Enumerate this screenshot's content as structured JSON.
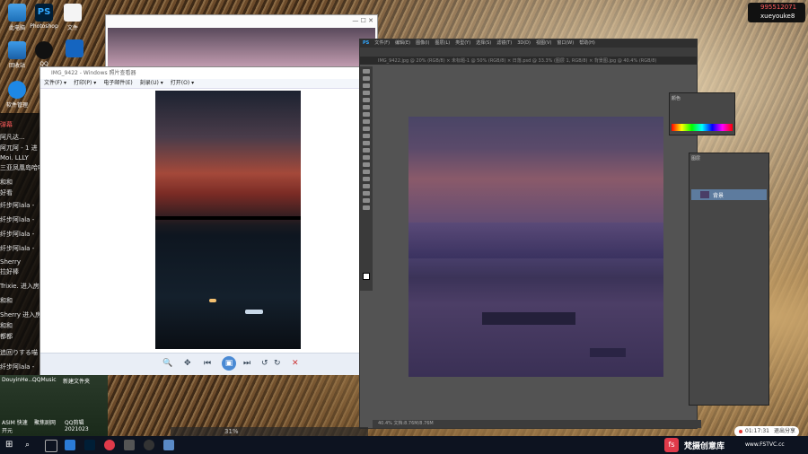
{
  "desktop_icons": [
    "此电脑",
    "Photoshop",
    "文件",
    "回收站",
    "QQ",
    "",
    "软件管理"
  ],
  "chat_lines": [
    "弹幕",
    "阿凡达...",
    "阿兀阿 - 1 进",
    "Moi. LLLY",
    "三亚凤凰岛哈哈",
    "和和",
    "好看",
    "纤步阿lala -",
    "纤步阿lala -",
    "纤步阿lala -",
    "纤步阿lala -",
    "Sherry",
    "拉好棒",
    "Trixie. 进入房",
    "和和",
    "Sherry 进入房",
    "和和",
    "都都",
    "追回りする喵 -",
    "纤步阿lala -"
  ],
  "viewer": {
    "title": "IMG_9422 - Windows 照片查看器",
    "menu": [
      "文件(F) ▾",
      "打印(P) ▾",
      "电子邮件(E)",
      "刻录(U) ▾",
      "打开(O) ▾"
    ]
  },
  "photoshop": {
    "logo": "PS",
    "menu": [
      "文件(F)",
      "编辑(E)",
      "图像(I)",
      "图层(L)",
      "类型(Y)",
      "选择(S)",
      "滤镜(T)",
      "3D(D)",
      "视图(V)",
      "窗口(W)",
      "帮助(H)"
    ],
    "tabs": "IMG_9422.jpg @ 20% (RGB/8)  ×  未标题-1 @ 50% (RGB/8)  ×  日落.psd @ 33.3% (图层 1, RGB/8)  ×  背景图.jpg @ 40.4% (RGB/8)",
    "status": "40.4%   文档:8.76M/8.76M",
    "color_panel_title": "颜色",
    "layers_panel_title": "图层",
    "layer_name": "背景"
  },
  "overlay": {
    "qq_number": "995512071",
    "user": "xueyouke8",
    "rec_time": "01:17:31",
    "rec_label": "退出分享",
    "watermark": "梵摄创意库",
    "watermark_url": "www.FSTVC.cc"
  },
  "bottom_desktop": [
    "DouyinHe...",
    "QQMusic",
    "新建文件夹",
    "ASIM 快速 开元",
    "聚焦剧网",
    "QQ剪辑 2021023"
  ],
  "bottom_zoom": "31%",
  "colors": {
    "ps_bg": "#535353",
    "taskbar": "#0d1320",
    "accent": "#e03a4a"
  }
}
